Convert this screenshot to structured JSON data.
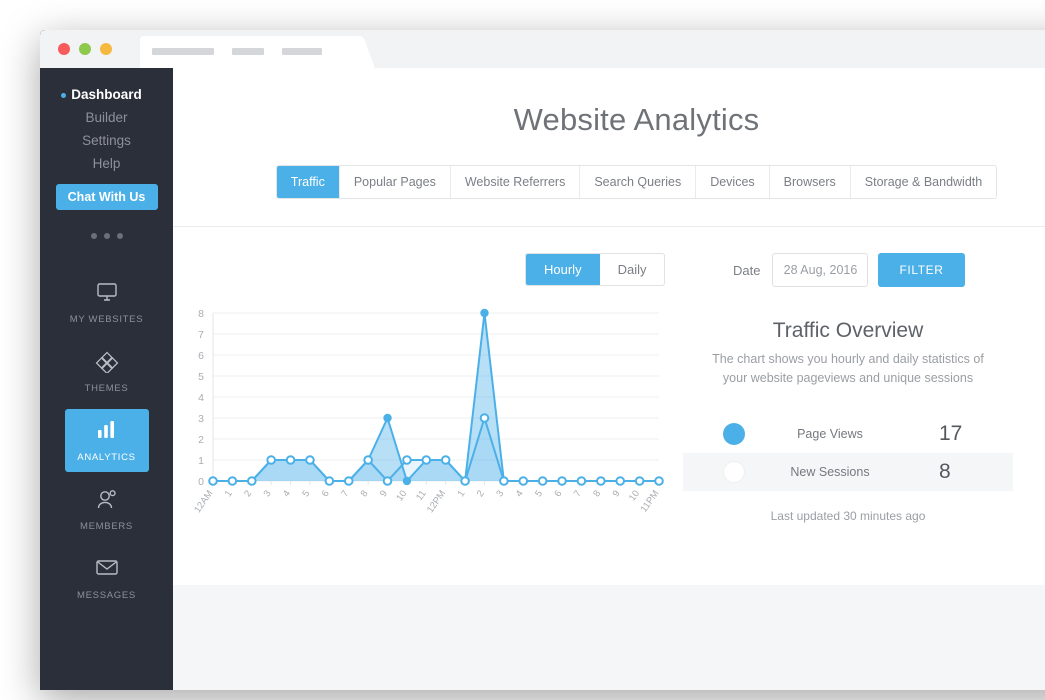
{
  "window": {
    "lights": [
      "close",
      "minimize",
      "maximize"
    ],
    "tab_placeholders": 3
  },
  "sidebar": {
    "links": [
      {
        "label": "Dashboard",
        "active": true
      },
      {
        "label": "Builder",
        "active": false
      },
      {
        "label": "Settings",
        "active": false
      },
      {
        "label": "Help",
        "active": false
      }
    ],
    "chat_button": "Chat With Us",
    "icon_items": [
      {
        "label": "MY WEBSITES",
        "icon": "monitor-icon",
        "active": false
      },
      {
        "label": "THEMES",
        "icon": "diamond-grid-icon",
        "active": false
      },
      {
        "label": "ANALYTICS",
        "icon": "bar-chart-icon",
        "active": true
      },
      {
        "label": "MEMBERS",
        "icon": "members-icon",
        "active": false
      },
      {
        "label": "MESSAGES",
        "icon": "envelope-icon",
        "active": false
      }
    ]
  },
  "header": {
    "title": "Website Analytics",
    "tabs": [
      {
        "label": "Traffic",
        "active": true
      },
      {
        "label": "Popular Pages",
        "active": false
      },
      {
        "label": "Website Referrers",
        "active": false
      },
      {
        "label": "Search Queries",
        "active": false
      },
      {
        "label": "Devices",
        "active": false
      },
      {
        "label": "Browsers",
        "active": false
      },
      {
        "label": "Storage & Bandwidth",
        "active": false
      }
    ]
  },
  "controls": {
    "interval": {
      "options": [
        "Hourly",
        "Daily"
      ],
      "selected": "Hourly"
    },
    "date_label": "Date",
    "date_value": "28 Aug, 2016",
    "date_placeholder": "28 Aug, 2016",
    "filter_button": "FILTER"
  },
  "overview": {
    "title": "Traffic Overview",
    "description": "The chart shows you hourly and daily statistics of your website pageviews and unique sessions",
    "metrics": [
      {
        "name": "Page Views",
        "value": "17",
        "color": "#4cb0e8"
      },
      {
        "name": "New Sessions",
        "value": "8",
        "color": "#ffffff"
      }
    ],
    "updated": "Last updated 30 minutes ago"
  },
  "colors": {
    "accent": "#4cb0e8",
    "sidebar": "#2b2f3a",
    "page_bg": "#f5f6f7"
  },
  "chart_data": {
    "type": "area",
    "title": "",
    "xlabel": "",
    "ylabel": "",
    "ylim": [
      0,
      8
    ],
    "yticks": [
      0,
      1,
      2,
      3,
      4,
      5,
      6,
      7,
      8
    ],
    "grid": true,
    "legend": "right-panel",
    "categories": [
      "12AM",
      "1",
      "2",
      "3",
      "4",
      "5",
      "6",
      "7",
      "8",
      "9",
      "10",
      "11",
      "12PM",
      "1",
      "2",
      "3",
      "4",
      "5",
      "6",
      "7",
      "8",
      "9",
      "10",
      "11PM"
    ],
    "series": [
      {
        "name": "Page Views",
        "color": "#4cb0e8",
        "marker": "filled",
        "values": [
          0,
          0,
          0,
          1,
          1,
          1,
          0,
          0,
          1,
          3,
          0,
          1,
          1,
          0,
          8,
          0,
          0,
          0,
          0,
          0,
          0,
          0,
          0,
          0
        ]
      },
      {
        "name": "New Sessions",
        "color": "#ffffff",
        "marker": "open",
        "values": [
          0,
          0,
          0,
          1,
          1,
          1,
          0,
          0,
          1,
          0,
          1,
          1,
          1,
          0,
          3,
          0,
          0,
          0,
          0,
          0,
          0,
          0,
          0,
          0
        ]
      }
    ]
  }
}
